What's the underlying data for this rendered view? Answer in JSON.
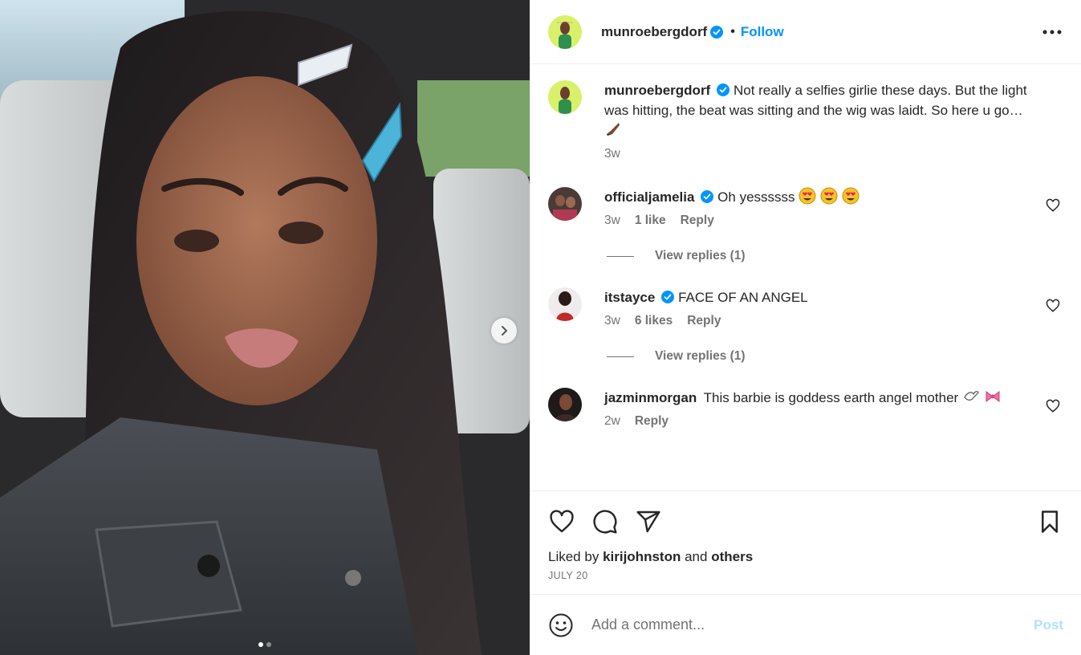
{
  "post": {
    "author": "munroebergdorf",
    "follow_label": "Follow",
    "separator": "•",
    "more_icon": "more-horizontal-icon",
    "image_count": 2,
    "active_image": 1
  },
  "caption": {
    "username": "munroebergdorf",
    "text": "Not really a selfies girlie these days. But the light was hitting, the beat was sitting and the wig was laidt. So here u go…",
    "emoji": "leg-emoji",
    "time": "3w"
  },
  "comments": [
    {
      "username": "officialjamelia",
      "text": "Oh yessssss",
      "emoji": "heart-eyes-emoji-x3",
      "time": "3w",
      "likes": "1 like",
      "reply_label": "Reply",
      "view_replies": "View replies (1)"
    },
    {
      "username": "itstayce",
      "text": "FACE OF AN ANGEL",
      "time": "3w",
      "likes": "6 likes",
      "reply_label": "Reply",
      "view_replies": "View replies (1)"
    },
    {
      "username": "jazminmorgan",
      "text": "This barbie is goddess earth angel mother",
      "emoji": "dove-bow-emoji",
      "time": "2w",
      "reply_label": "Reply"
    }
  ],
  "engagement": {
    "liked_prefix": "Liked by",
    "liked_user": "kirijohnston",
    "liked_and": "and",
    "liked_others": "others",
    "date": "JULY 20"
  },
  "composer": {
    "placeholder": "Add a comment...",
    "post_label": "Post"
  },
  "colors": {
    "accent": "#0095f6",
    "verified": "#0095f6",
    "muted": "#737373",
    "post_disabled": "#b2dffc"
  }
}
